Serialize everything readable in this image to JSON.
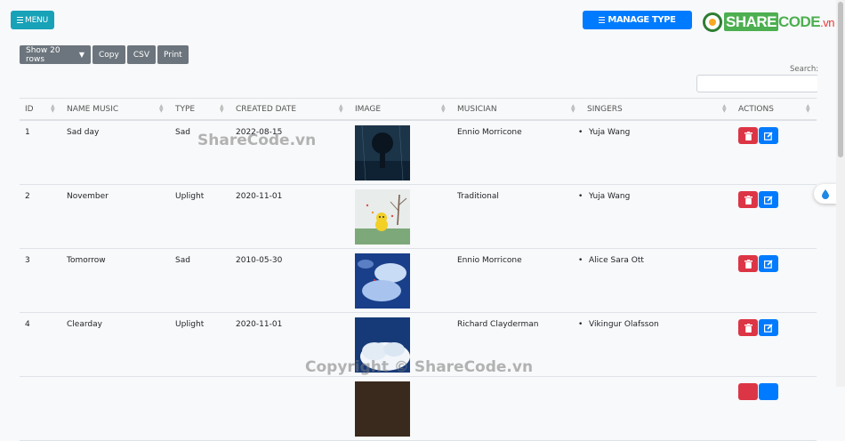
{
  "header": {
    "menu_label": "MENU",
    "manage_label": "MANAGE TYPE",
    "logo": {
      "share": "SHARE",
      "code": "CODE",
      "vn": ".vn"
    }
  },
  "toolbar": {
    "show_rows": "Show 20 rows",
    "copy": "Copy",
    "csv": "CSV",
    "print": "Print"
  },
  "search": {
    "label": "Search:",
    "value": ""
  },
  "table": {
    "columns": [
      "ID",
      "NAME MUSIC",
      "TYPE",
      "CREATED DATE",
      "IMAGE",
      "MUSICIAN",
      "SINGERS",
      "ACTIONS"
    ],
    "rows": [
      {
        "id": "1",
        "name": "Sad day",
        "type": "Sad",
        "date": "2022-08-15",
        "image": "rainy-night-figure",
        "musician": "Ennio Morricone",
        "singer": "Yuja Wang"
      },
      {
        "id": "2",
        "name": "November",
        "type": "Uplight",
        "date": "2020-11-01",
        "image": "autumn-cartoon",
        "musician": "Traditional",
        "singer": "Yuja Wang"
      },
      {
        "id": "3",
        "name": "Tomorrow",
        "type": "Sad",
        "date": "2010-05-30",
        "image": "blue-sky-clouds",
        "musician": "Ennio Morricone",
        "singer": "Alice Sara Ott"
      },
      {
        "id": "4",
        "name": "Clearday",
        "type": "Uplight",
        "date": "2020-11-01",
        "image": "white-clouds",
        "musician": "Richard Clayderman",
        "singer": "Vikingur Olafsson"
      }
    ]
  },
  "watermarks": {
    "top": "ShareCode.vn",
    "bottom": "Copyright © ShareCode.vn"
  },
  "icons": {
    "menu": "hamburger-icon",
    "delete": "trash-icon",
    "edit": "edit-icon",
    "float": "water-drop-icon"
  },
  "colors": {
    "menu": "#17a2b8",
    "manage": "#007bff",
    "delete": "#dc3545",
    "edit": "#007bff",
    "toolbar": "#6c757d"
  }
}
